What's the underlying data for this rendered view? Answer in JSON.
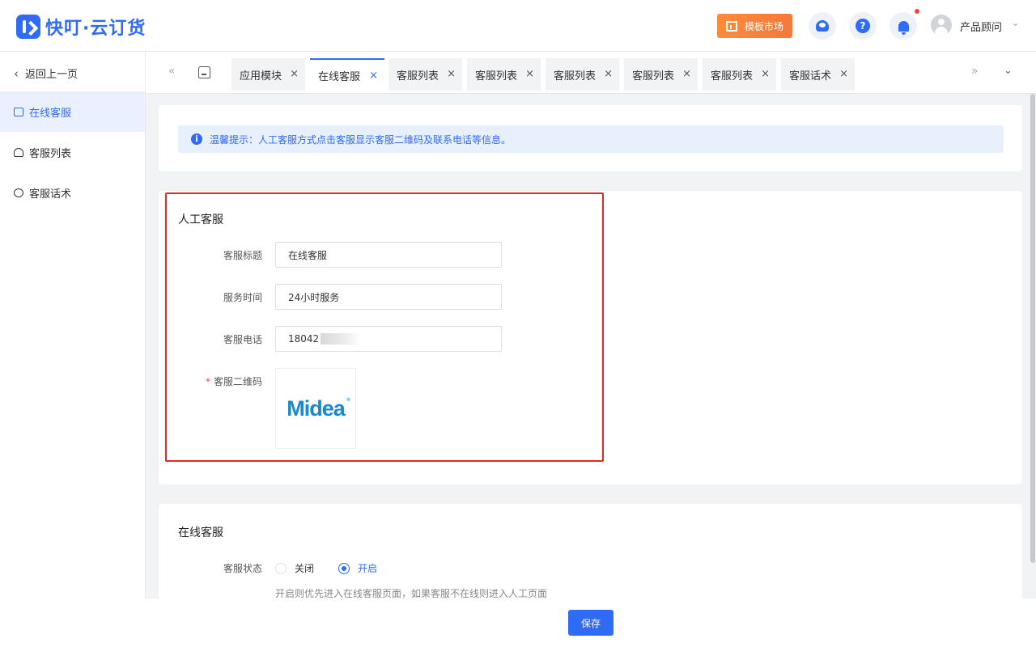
{
  "app": {
    "logo_text": "快叮·云订货"
  },
  "header": {
    "template_market": "模板市场",
    "help_glyph": "?",
    "user_name": "产品顾问",
    "user_caret": "⌄"
  },
  "sidebar": {
    "back": "返回上一页",
    "items": [
      {
        "label": "在线客服",
        "active": true
      },
      {
        "label": "客服列表",
        "active": false
      },
      {
        "label": "客服话术",
        "active": false
      }
    ]
  },
  "tabs": [
    {
      "label": "应用模块",
      "active": false
    },
    {
      "label": "在线客服",
      "active": true
    },
    {
      "label": "客服列表",
      "active": false
    },
    {
      "label": "客服列表",
      "active": false
    },
    {
      "label": "客服列表",
      "active": false
    },
    {
      "label": "客服列表",
      "active": false
    },
    {
      "label": "客服列表",
      "active": false
    },
    {
      "label": "客服话术",
      "active": false
    }
  ],
  "tab_close": "×",
  "tip": {
    "icon": "i",
    "text": "温馨提示：人工客服方式点击客服显示客服二维码及联系电话等信息。"
  },
  "manual": {
    "title": "人工客服",
    "fields": [
      {
        "label": "客服标题",
        "value": "在线客服"
      },
      {
        "label": "服务时间",
        "value": "24小时服务"
      },
      {
        "label": "客服电话",
        "value": "18042"
      }
    ],
    "qr_required_mark": "*",
    "qr_label": "客服二维码",
    "qr_logo_text": "Midea"
  },
  "online": {
    "title": "在线客服",
    "status_label": "客服状态",
    "options": [
      {
        "label": "关闭",
        "selected": false
      },
      {
        "label": "开启",
        "selected": true
      }
    ],
    "hint": "开启则优先进入在线客服页面，如果客服不在线则进入人工页面"
  },
  "footer": {
    "save": "保存"
  },
  "colors": {
    "accent": "#2f6bf5",
    "highlight_border": "#e02a22",
    "orange": "#f5793b"
  }
}
